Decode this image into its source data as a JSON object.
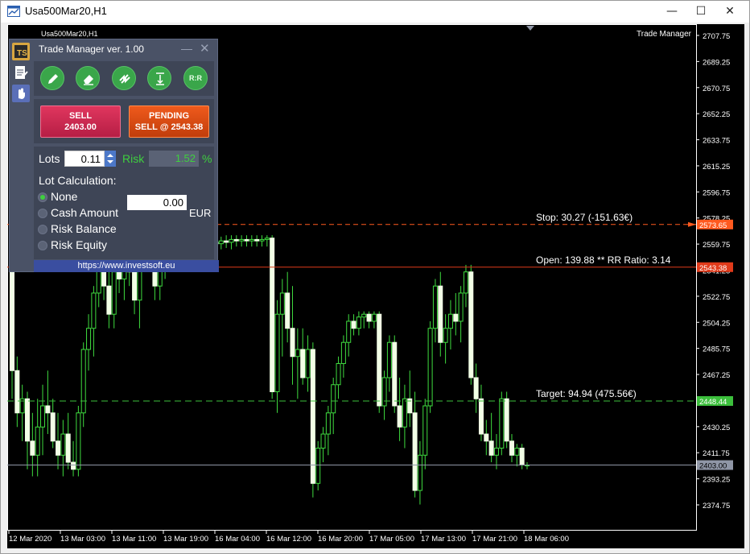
{
  "window": {
    "title": "Usa500Mar20,H1",
    "minimize": "—",
    "maximize": "☐",
    "close": "✕"
  },
  "chart": {
    "symbol_label": "Usa500Mar20,H1",
    "brand": "Trade Manager",
    "lines": {
      "stop": {
        "label": "Stop: 30.27 (-151.63€)",
        "price": 2573.65,
        "price_label": "2573.65",
        "color": "#ff5a1f"
      },
      "open": {
        "label": "Open: 139.88 ** RR Ratio: 3.14",
        "price": 2543.38,
        "price_label": "2543.38",
        "color": "#e03a1a"
      },
      "target": {
        "label": "Target: 94.94 (475.56€)",
        "price": 2448.44,
        "price_label": "2448.44",
        "color": "#3cbf3c"
      },
      "current": {
        "price": 2403.0,
        "price_label": "2403.00",
        "color": "#8f96a6"
      }
    },
    "price_axis": [
      "2707.75",
      "2689.25",
      "2670.75",
      "2652.25",
      "2633.75",
      "2615.25",
      "2596.75",
      "2578.25",
      "2559.75",
      "2541.25",
      "2522.75",
      "2504.25",
      "2485.75",
      "2467.25",
      "2448.75",
      "2430.25",
      "2411.75",
      "2393.25",
      "2374.75"
    ],
    "time_axis": [
      "12 Mar 2020",
      "13 Mar 03:00",
      "13 Mar 11:00",
      "13 Mar 19:00",
      "16 Mar 04:00",
      "16 Mar 12:00",
      "16 Mar 20:00",
      "17 Mar 05:00",
      "17 Mar 13:00",
      "17 Mar 21:00",
      "18 Mar 06:00"
    ]
  },
  "trade_manager": {
    "title": "Trade Manager ver. 1.00",
    "min": "—",
    "close": "✕",
    "tools": [
      "pencil-icon",
      "eraser-icon",
      "reverse-icon",
      "breakeven-icon",
      "R:R"
    ],
    "sell": {
      "line1": "SELL",
      "line2": "2403.00"
    },
    "pending": {
      "line1": "PENDING",
      "line2": "SELL @ 2543.38"
    },
    "lots_label": "Lots",
    "lots_value": "0.11",
    "risk_label": "Risk",
    "risk_value": "1.52",
    "risk_unit": "%",
    "lot_calc_label": "Lot Calculation:",
    "options": [
      {
        "label": "None",
        "selected": true
      },
      {
        "label": "Cash Amount",
        "selected": false
      },
      {
        "label": "Risk Balance",
        "selected": false
      },
      {
        "label": "Risk Equity",
        "selected": false
      }
    ],
    "cash_value": "0.00",
    "cash_unit": "EUR",
    "footer": "https://www.investsoft.eu"
  }
}
